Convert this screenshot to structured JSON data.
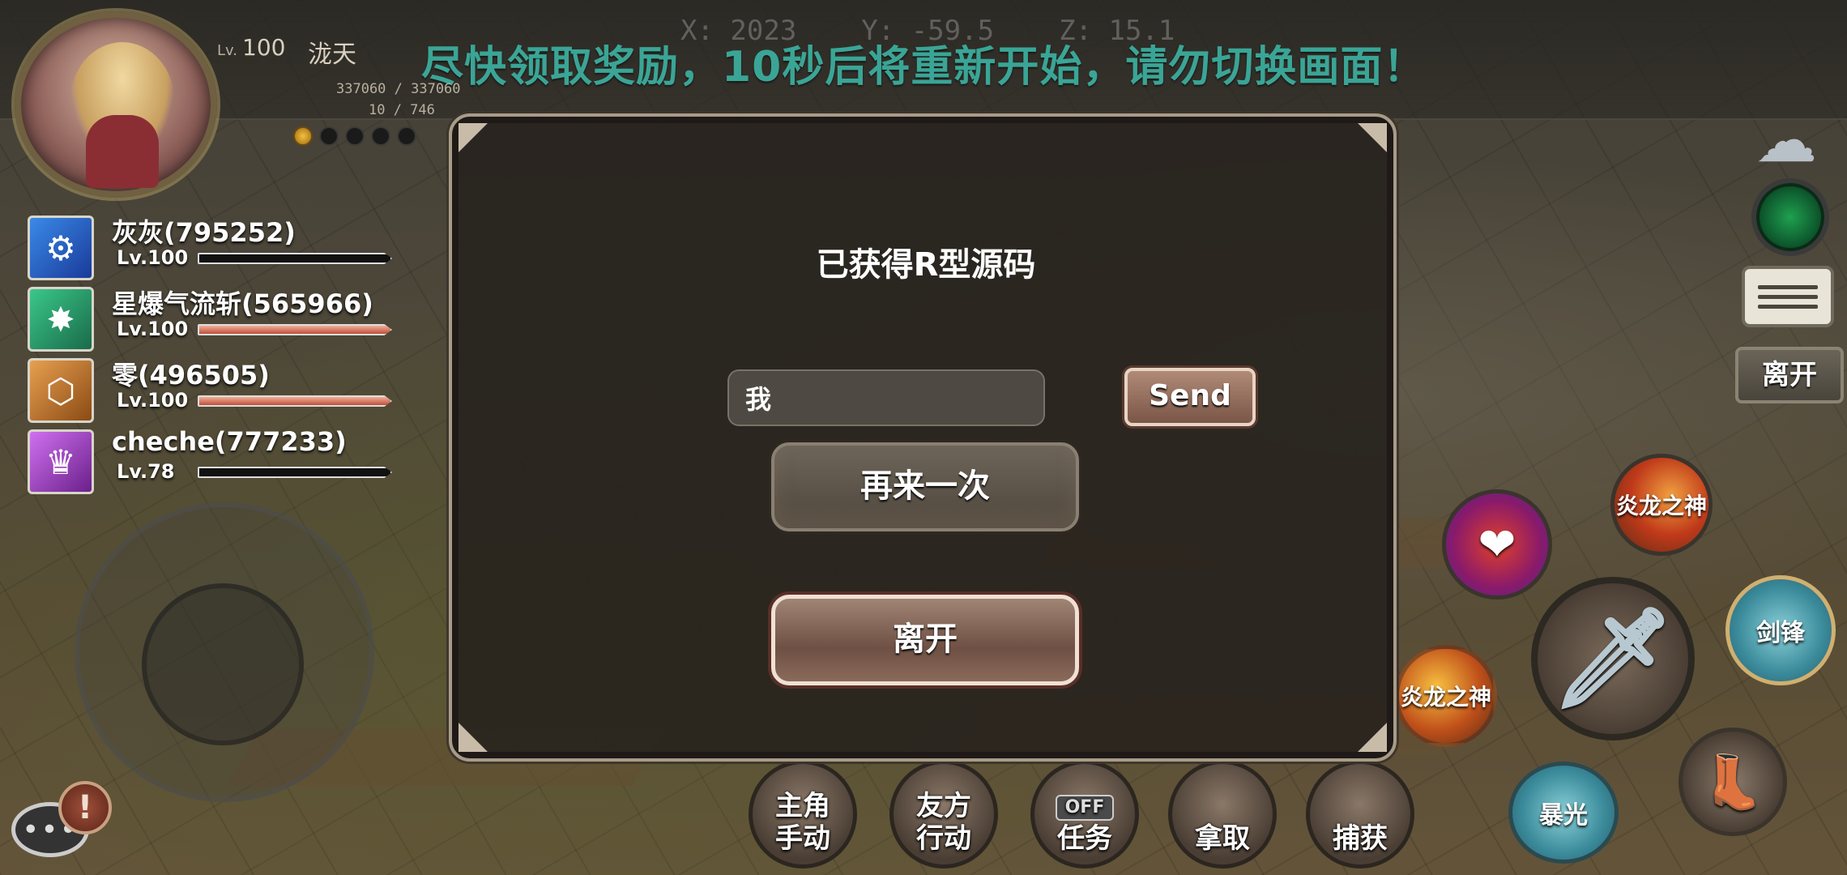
{
  "hud": {
    "coords": {
      "x": "X: 2023",
      "y": "Y: -59.5",
      "z": "Z: 15.1"
    },
    "notice": "尽快领取奖励，10秒后将重新开始，请勿切换画面！"
  },
  "player": {
    "level_prefix": "Lv.",
    "level": "100",
    "name": "泷天",
    "hp": "337060 / 337060",
    "mp": "10 / 746",
    "energy": {
      "filled": 1,
      "total": 5
    }
  },
  "team": [
    {
      "name": "灰灰(795252)",
      "level": "Lv.100",
      "hp_fraction": 0.0,
      "icon": "gear-clock-icon",
      "color": "#2a6ad0"
    },
    {
      "name": "星爆气流斩(565966)",
      "level": "Lv.100",
      "hp_fraction": 1.0,
      "icon": "starburst-icon",
      "color": "#2a9a6a"
    },
    {
      "name": "零(496505)",
      "level": "Lv.100",
      "hp_fraction": 1.0,
      "icon": "hexagon-shield-icon",
      "color": "#c86a20"
    },
    {
      "name": "cheche(777233)",
      "level": "Lv.78",
      "hp_fraction": 0.0,
      "icon": "crown-treasure-icon",
      "color": "#a040c8"
    }
  ],
  "modal": {
    "title": "已获得R型源码",
    "chat_value": "我",
    "send_label": "Send",
    "retry_label": "再来一次",
    "leave_label": "离开"
  },
  "right_panel": {
    "leave_label": "离开"
  },
  "skills": {
    "dragon_god_1": "炎龙之神",
    "dragon_god_2": "炎龙之神",
    "jianfeng": "剑锋",
    "baoguang": "暴光"
  },
  "actions": [
    {
      "label_top": "主角",
      "label_bottom": "手动"
    },
    {
      "label_top": "友方",
      "label_bottom": "行动"
    },
    {
      "tag": "OFF",
      "label_bottom": "任务"
    },
    {
      "label_bottom": "拿取"
    },
    {
      "label_bottom": "捕获"
    }
  ]
}
